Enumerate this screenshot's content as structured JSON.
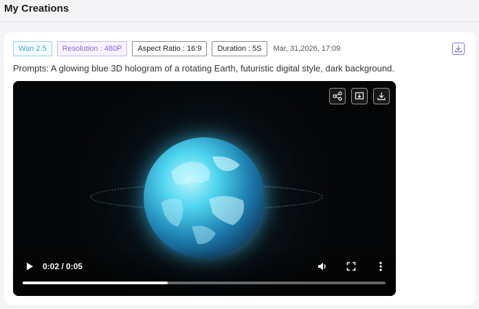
{
  "page": {
    "title": "My Creations"
  },
  "creation": {
    "tags": {
      "model": "Wan 2.5",
      "resolution": "Resolution : 480P",
      "aspect_ratio": "Aspect Ratio : 16:9",
      "duration": "Duration : 5S"
    },
    "timestamp": "Mar, 31,2026, 17:09",
    "prompt": "Prompts: A glowing blue 3D hologram of a rotating Earth, futuristic digital style, dark background."
  },
  "player": {
    "time_display": "0:02 / 0:05",
    "progress_fraction": 0.4,
    "icons": [
      "share-icon",
      "picture-in-picture-icon",
      "download-icon",
      "play-icon",
      "volume-icon",
      "fullscreen-icon",
      "more-options-icon"
    ]
  },
  "colors": {
    "model_tag": "#3ea8d6",
    "resolution_tag": "#8a63d6",
    "download_accent": "#7b6fd8"
  }
}
